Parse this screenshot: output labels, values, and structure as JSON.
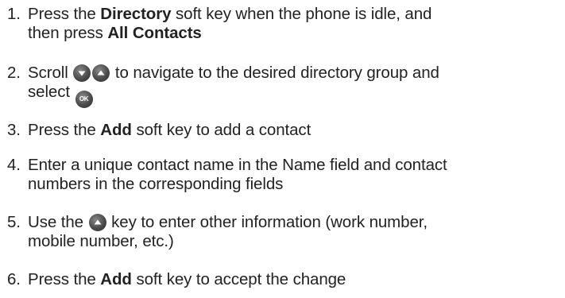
{
  "steps": [
    {
      "number": "1.",
      "line1_a": "Press the ",
      "line1_b": "Directory",
      "line1_c": " soft key when the phone is idle, and",
      "line2_a": "then press ",
      "line2_b": "All Contacts"
    },
    {
      "number": "2.",
      "line1_a": "Scroll ",
      "line1_b": " to navigate to the desired directory group and",
      "line2_a": "select "
    },
    {
      "number": "3.",
      "line1_a": "Press the ",
      "line1_b": "Add",
      "line1_c": " soft key to add a contact"
    },
    {
      "number": "4.",
      "line1": "Enter a unique contact name in the Name field and contact",
      "line2": "numbers in the corresponding fields"
    },
    {
      "number": "5.",
      "line1_a": "Use the ",
      "line1_b": " key to enter other information (work number,",
      "line2": "mobile number, etc.)"
    },
    {
      "number": "6.",
      "line1_a": "Press the ",
      "line1_b": "Add",
      "line1_c": " soft key to accept the change"
    }
  ],
  "icons": {
    "ok_label": "OK",
    "key_color": "#4a4a4a"
  }
}
